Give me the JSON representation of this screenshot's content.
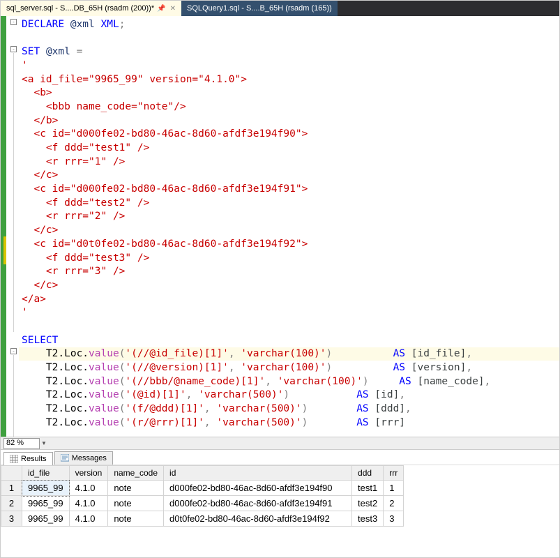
{
  "tabs": [
    {
      "label": "sql_server.sql - S....DB_65H (rsadm (200))*",
      "active": true
    },
    {
      "label": "SQLQuery1.sql - S....B_65H (rsadm (165))",
      "active": false
    }
  ],
  "zoom": "82 %",
  "code": {
    "l1_declare": "DECLARE",
    "l1_var": "@xml",
    "l1_type": "XML",
    "l1_semi": ";",
    "l3_set": "SET",
    "l3_var": "@xml",
    "l3_eq": "=",
    "l4": "'",
    "l5": "<a id_file=\"9965_99\" version=\"4.1.0\">",
    "l6": "  <b>",
    "l7": "    <bbb name_code=\"note\"/>",
    "l8": "  </b>",
    "l9": "  <c id=\"d000fe02-bd80-46ac-8d60-afdf3e194f90\">",
    "l10": "    <f ddd=\"test1\" />",
    "l11": "    <r rrr=\"1\" />",
    "l12": "  </c>",
    "l13": "  <c id=\"d000fe02-bd80-46ac-8d60-afdf3e194f91\">",
    "l14": "    <f ddd=\"test2\" />",
    "l15": "    <r rrr=\"2\" />",
    "l16": "  </c>",
    "l17": "  <c id=\"d0t0fe02-bd80-46ac-8d60-afdf3e194f92\">",
    "l18": "    <f ddd=\"test3\" />",
    "l19": "    <r rrr=\"3\" />",
    "l20": "  </c>",
    "l21": "</a>",
    "l22": "'",
    "select": "SELECT",
    "q1_a": "    T2.Loc.",
    "q1_fn": "value",
    "q1_p": "(",
    "q1_s1": "'(//@id_file)[1]'",
    "q1_c": ",",
    "q1_s2": "'varchar(100)'",
    "q1_cp": ")",
    "q1_sp": "          ",
    "q1_as": "AS",
    "q1_col": " [id_file]",
    "q1_e": ",",
    "q2_a": "    T2.Loc.",
    "q2_fn": "value",
    "q2_p": "(",
    "q2_s1": "'(//@version)[1]'",
    "q2_c": ",",
    "q2_s2": "'varchar(100)'",
    "q2_cp": ")",
    "q2_sp": "          ",
    "q2_as": "AS",
    "q2_col": " [version]",
    "q2_e": ",",
    "q3_a": "    T2.Loc.",
    "q3_fn": "value",
    "q3_p": "(",
    "q3_s1": "'(//bbb/@name_code)[1]'",
    "q3_c": ",",
    "q3_s2": "'varchar(100)'",
    "q3_cp": ")",
    "q3_sp": "     ",
    "q3_as": "AS",
    "q3_col": " [name_code]",
    "q3_e": ",",
    "q4_a": "    T2.Loc.",
    "q4_fn": "value",
    "q4_p": "(",
    "q4_s1": "'(@id)[1]'",
    "q4_c": ",",
    "q4_s2": "'varchar(500)'",
    "q4_cp": ")",
    "q4_sp": "           ",
    "q4_as": "AS",
    "q4_col": " [id]",
    "q4_e": ",",
    "q5_a": "    T2.Loc.",
    "q5_fn": "value",
    "q5_p": "(",
    "q5_s1": "'(f/@ddd)[1]'",
    "q5_c": ",",
    "q5_s2": "'varchar(500)'",
    "q5_cp": ")",
    "q5_sp": "        ",
    "q5_as": "AS",
    "q5_col": " [ddd]",
    "q5_e": ",",
    "q6_a": "    T2.Loc.",
    "q6_fn": "value",
    "q6_p": "(",
    "q6_s1": "'(r/@rrr)[1]'",
    "q6_c": ",",
    "q6_s2": "'varchar(500)'",
    "q6_cp": ")",
    "q6_sp": "        ",
    "q6_as": "AS",
    "q6_col": " [rrr]"
  },
  "results": {
    "tabs": {
      "results": "Results",
      "messages": "Messages"
    },
    "headers": [
      "id_file",
      "version",
      "name_code",
      "id",
      "ddd",
      "rrr"
    ],
    "rows": [
      {
        "n": "1",
        "id_file": "9965_99",
        "version": "4.1.0",
        "name_code": "note",
        "id": "d000fe02-bd80-46ac-8d60-afdf3e194f90",
        "ddd": "test1",
        "rrr": "1"
      },
      {
        "n": "2",
        "id_file": "9965_99",
        "version": "4.1.0",
        "name_code": "note",
        "id": "d000fe02-bd80-46ac-8d60-afdf3e194f91",
        "ddd": "test2",
        "rrr": "2"
      },
      {
        "n": "3",
        "id_file": "9965_99",
        "version": "4.1.0",
        "name_code": "note",
        "id": "d0t0fe02-bd80-46ac-8d60-afdf3e194f92",
        "ddd": "test3",
        "rrr": "3"
      }
    ]
  }
}
